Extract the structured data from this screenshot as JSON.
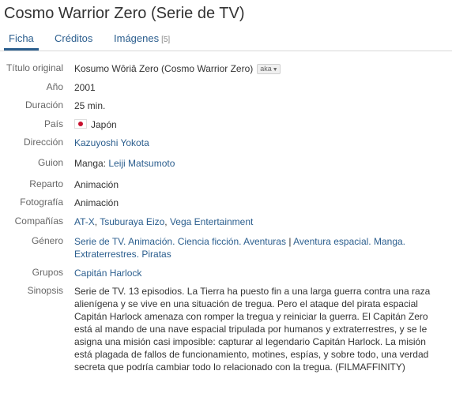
{
  "title": "Cosmo Warrior Zero (Serie de TV)",
  "tabs": {
    "ficha": "Ficha",
    "creditos": "Créditos",
    "imagenes": "Imágenes",
    "imagenes_count": "[5]"
  },
  "fields": {
    "titulo_original": {
      "label": "Título original",
      "value": "Kosumo Wôriâ Zero (Cosmo Warrior Zero)",
      "aka": "aka"
    },
    "anio": {
      "label": "Año",
      "value": "2001"
    },
    "duracion": {
      "label": "Duración",
      "value": "25 min."
    },
    "pais": {
      "label": "País",
      "value": "Japón",
      "flag_icon": "japan-flag-icon"
    },
    "direccion": {
      "label": "Dirección",
      "value": "Kazuyoshi Yokota"
    },
    "guion": {
      "label": "Guion",
      "prefix": "Manga:",
      "value": "Leiji Matsumoto"
    },
    "reparto": {
      "label": "Reparto",
      "value": "Animación"
    },
    "fotografia": {
      "label": "Fotografía",
      "value": "Animación"
    },
    "companias": {
      "label": "Compañías",
      "items": [
        "AT-X",
        "Tsuburaya Eizo",
        "Vega Entertainment"
      ]
    },
    "genero": {
      "label": "Género",
      "items": [
        "Serie de TV",
        "Animación",
        "Ciencia ficción",
        "Aventuras"
      ],
      "separator": "|",
      "topics": [
        "Aventura espacial",
        "Manga",
        "Extraterrestres",
        "Piratas"
      ]
    },
    "grupos": {
      "label": "Grupos",
      "value": "Capitán Harlock"
    },
    "sinopsis": {
      "label": "Sinopsis",
      "value": "Serie de TV. 13 episodios. La Tierra ha puesto fin a una larga guerra contra una raza alienígena y se vive en una situación de tregua. Pero el ataque del pirata espacial Capitán Harlock amenaza con romper la tregua y reiniciar la guerra. El Capitán Zero está al mando de una nave espacial tripulada por humanos y extraterrestres, y se le asigna una misión casi imposible: capturar al legendario Capitán Harlock. La misión está plagada de fallos de funcionamiento, motines, espías, y sobre todo, una verdad secreta que podría cambiar todo lo relacionado con la tregua. (FILMAFFINITY)"
    }
  },
  "colors": {
    "link": "#2b5e8e",
    "label": "#666666",
    "text": "#333333"
  }
}
